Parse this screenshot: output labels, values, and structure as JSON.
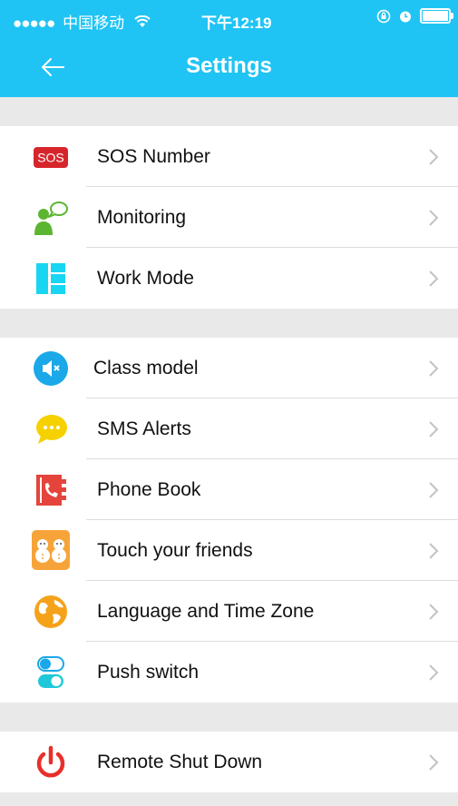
{
  "status_bar": {
    "signal": "●●●●●",
    "carrier": "中国移动",
    "time": "下午12:19"
  },
  "header": {
    "title": "Settings",
    "back_icon": "arrow-left-icon"
  },
  "groups": [
    {
      "items": [
        {
          "label": "SOS Number",
          "icon": "sos-icon",
          "icon_text": "SOS"
        },
        {
          "label": "Monitoring",
          "icon": "monitoring-person-icon"
        },
        {
          "label": "Work Mode",
          "icon": "work-mode-icon"
        }
      ]
    },
    {
      "items": [
        {
          "label": "Class model",
          "icon": "mute-speaker-icon"
        },
        {
          "label": "SMS Alerts",
          "icon": "chat-bubble-icon"
        },
        {
          "label": "Phone Book",
          "icon": "phone-book-icon"
        },
        {
          "label": "Touch your friends",
          "icon": "friends-icon"
        },
        {
          "label": "Language and Time Zone",
          "icon": "globe-icon"
        },
        {
          "label": "Push switch",
          "icon": "toggle-switch-icon"
        }
      ]
    },
    {
      "items": [
        {
          "label": "Remote Shut Down",
          "icon": "power-icon"
        }
      ]
    }
  ],
  "colors": {
    "header": "#20c4f4",
    "background": "#e9e9e9",
    "sos_red": "#d6262c",
    "power_red": "#e8302a"
  }
}
